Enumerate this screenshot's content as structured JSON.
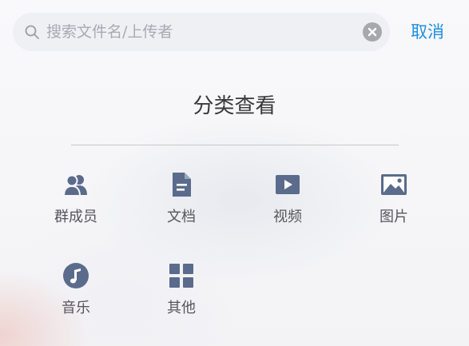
{
  "search": {
    "placeholder": "搜索文件名/上传者",
    "value": ""
  },
  "cancel_label": "取消",
  "section_title": "分类查看",
  "categories": [
    {
      "label": "群成员",
      "icon": "group-members-icon"
    },
    {
      "label": "文档",
      "icon": "document-icon"
    },
    {
      "label": "视频",
      "icon": "video-icon"
    },
    {
      "label": "图片",
      "icon": "image-icon"
    },
    {
      "label": "音乐",
      "icon": "music-icon"
    },
    {
      "label": "其他",
      "icon": "other-icon"
    }
  ],
  "colors": {
    "accent": "#1d8fe0",
    "icon": "#5a6b8c",
    "text": "#56565a",
    "search_bg": "#eef0f4"
  }
}
